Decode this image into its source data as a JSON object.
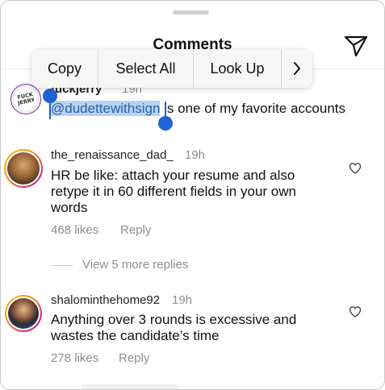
{
  "header": {
    "title": "Comments"
  },
  "context_menu": {
    "copy": "Copy",
    "select_all": "Select All",
    "look_up": "Look Up",
    "more": "›"
  },
  "comments": [
    {
      "username": "fuckjerry",
      "time": "19h",
      "mention": "@dudettewithsign",
      "text_rest": " is one of my favorite accounts",
      "avatar_text": [
        "FUCK",
        "JERRY"
      ]
    },
    {
      "username": "the_renaissance_dad_",
      "time": "19h",
      "lines": [
        "HR be like: attach your resume and also",
        "retype it in 60 different fields in your own",
        "words"
      ],
      "likes": "468 likes",
      "reply": "Reply",
      "view_replies": "View 5 more replies"
    },
    {
      "username": "shalominthehome92",
      "time": "19h",
      "lines": [
        "Anything over 3 rounds is excessive and",
        "wastes the candidate’s time"
      ],
      "likes": "278 likes",
      "reply": "Reply"
    }
  ],
  "colors": {
    "selection": "#b8d3f3",
    "handle": "#1f63d6",
    "muted": "#8e8e8e"
  },
  "icons": [
    "share-icon",
    "heart-icon",
    "chevron-right-icon"
  ]
}
